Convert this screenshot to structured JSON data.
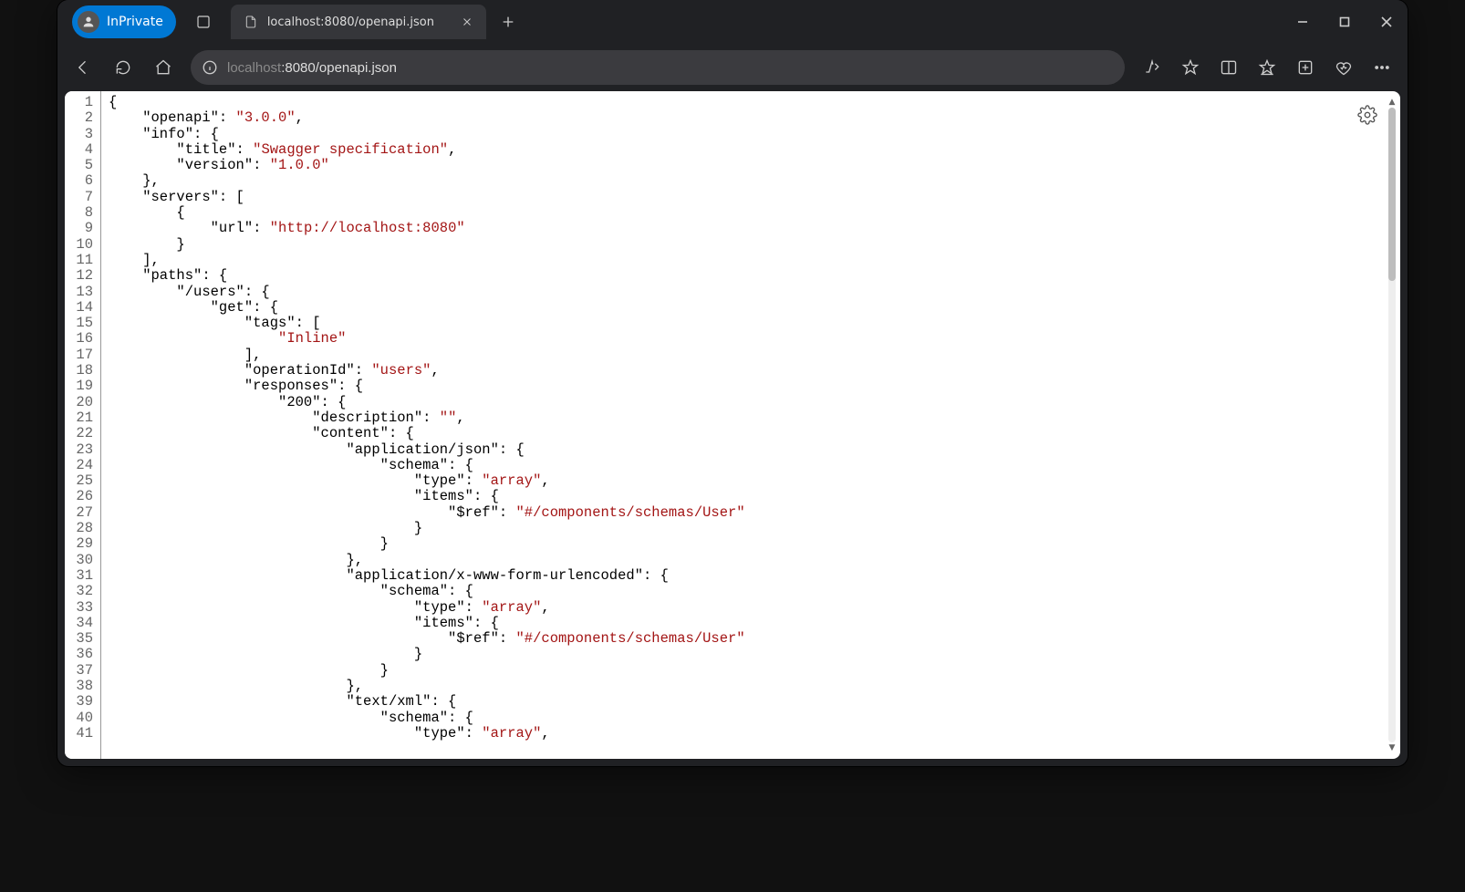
{
  "titlebar": {
    "inprivate_label": "InPrivate",
    "tab_title": "localhost:8080/openapi.json"
  },
  "toolbar": {
    "url_host_dim": "localhost",
    "url_port_path": ":8080/openapi.json"
  },
  "code_lines": [
    {
      "n": 1,
      "segs": [
        [
          "p",
          "{"
        ]
      ]
    },
    {
      "n": 2,
      "segs": [
        [
          "p",
          "    \"openapi\": "
        ],
        [
          "k",
          "\"3.0.0\""
        ],
        [
          "p",
          ","
        ]
      ]
    },
    {
      "n": 3,
      "segs": [
        [
          "p",
          "    \"info\": {"
        ]
      ]
    },
    {
      "n": 4,
      "segs": [
        [
          "p",
          "        \"title\": "
        ],
        [
          "k",
          "\"Swagger specification\""
        ],
        [
          "p",
          ","
        ]
      ]
    },
    {
      "n": 5,
      "segs": [
        [
          "p",
          "        \"version\": "
        ],
        [
          "k",
          "\"1.0.0\""
        ]
      ]
    },
    {
      "n": 6,
      "segs": [
        [
          "p",
          "    },"
        ]
      ]
    },
    {
      "n": 7,
      "segs": [
        [
          "p",
          "    \"servers\": ["
        ]
      ]
    },
    {
      "n": 8,
      "segs": [
        [
          "p",
          "        {"
        ]
      ]
    },
    {
      "n": 9,
      "segs": [
        [
          "p",
          "            \"url\": "
        ],
        [
          "k",
          "\"http://localhost:8080\""
        ]
      ]
    },
    {
      "n": 10,
      "segs": [
        [
          "p",
          "        }"
        ]
      ]
    },
    {
      "n": 11,
      "segs": [
        [
          "p",
          "    ],"
        ]
      ]
    },
    {
      "n": 12,
      "segs": [
        [
          "p",
          "    \"paths\": {"
        ]
      ]
    },
    {
      "n": 13,
      "segs": [
        [
          "p",
          "        \"/users\": {"
        ]
      ]
    },
    {
      "n": 14,
      "segs": [
        [
          "p",
          "            \"get\": {"
        ]
      ]
    },
    {
      "n": 15,
      "segs": [
        [
          "p",
          "                \"tags\": ["
        ]
      ]
    },
    {
      "n": 16,
      "segs": [
        [
          "p",
          "                    "
        ],
        [
          "k",
          "\"Inline\""
        ]
      ]
    },
    {
      "n": 17,
      "segs": [
        [
          "p",
          "                ],"
        ]
      ]
    },
    {
      "n": 18,
      "segs": [
        [
          "p",
          "                \"operationId\": "
        ],
        [
          "k",
          "\"users\""
        ],
        [
          "p",
          ","
        ]
      ]
    },
    {
      "n": 19,
      "segs": [
        [
          "p",
          "                \"responses\": {"
        ]
      ]
    },
    {
      "n": 20,
      "segs": [
        [
          "p",
          "                    \"200\": {"
        ]
      ]
    },
    {
      "n": 21,
      "segs": [
        [
          "p",
          "                        \"description\": "
        ],
        [
          "k",
          "\"\""
        ],
        [
          "p",
          ","
        ]
      ]
    },
    {
      "n": 22,
      "segs": [
        [
          "p",
          "                        \"content\": {"
        ]
      ]
    },
    {
      "n": 23,
      "segs": [
        [
          "p",
          "                            \"application/json\": {"
        ]
      ]
    },
    {
      "n": 24,
      "segs": [
        [
          "p",
          "                                \"schema\": {"
        ]
      ]
    },
    {
      "n": 25,
      "segs": [
        [
          "p",
          "                                    \"type\": "
        ],
        [
          "k",
          "\"array\""
        ],
        [
          "p",
          ","
        ]
      ]
    },
    {
      "n": 26,
      "segs": [
        [
          "p",
          "                                    \"items\": {"
        ]
      ]
    },
    {
      "n": 27,
      "segs": [
        [
          "p",
          "                                        \"$ref\": "
        ],
        [
          "k",
          "\"#/components/schemas/User\""
        ]
      ]
    },
    {
      "n": 28,
      "segs": [
        [
          "p",
          "                                    }"
        ]
      ]
    },
    {
      "n": 29,
      "segs": [
        [
          "p",
          "                                }"
        ]
      ]
    },
    {
      "n": 30,
      "segs": [
        [
          "p",
          "                            },"
        ]
      ]
    },
    {
      "n": 31,
      "segs": [
        [
          "p",
          "                            \"application/x-www-form-urlencoded\": {"
        ]
      ]
    },
    {
      "n": 32,
      "segs": [
        [
          "p",
          "                                \"schema\": {"
        ]
      ]
    },
    {
      "n": 33,
      "segs": [
        [
          "p",
          "                                    \"type\": "
        ],
        [
          "k",
          "\"array\""
        ],
        [
          "p",
          ","
        ]
      ]
    },
    {
      "n": 34,
      "segs": [
        [
          "p",
          "                                    \"items\": {"
        ]
      ]
    },
    {
      "n": 35,
      "segs": [
        [
          "p",
          "                                        \"$ref\": "
        ],
        [
          "k",
          "\"#/components/schemas/User\""
        ]
      ]
    },
    {
      "n": 36,
      "segs": [
        [
          "p",
          "                                    }"
        ]
      ]
    },
    {
      "n": 37,
      "segs": [
        [
          "p",
          "                                }"
        ]
      ]
    },
    {
      "n": 38,
      "segs": [
        [
          "p",
          "                            },"
        ]
      ]
    },
    {
      "n": 39,
      "segs": [
        [
          "p",
          "                            \"text/xml\": {"
        ]
      ]
    },
    {
      "n": 40,
      "segs": [
        [
          "p",
          "                                \"schema\": {"
        ]
      ]
    },
    {
      "n": 41,
      "segs": [
        [
          "p",
          "                                    \"type\": "
        ],
        [
          "k",
          "\"array\""
        ],
        [
          "p",
          ","
        ]
      ]
    }
  ]
}
